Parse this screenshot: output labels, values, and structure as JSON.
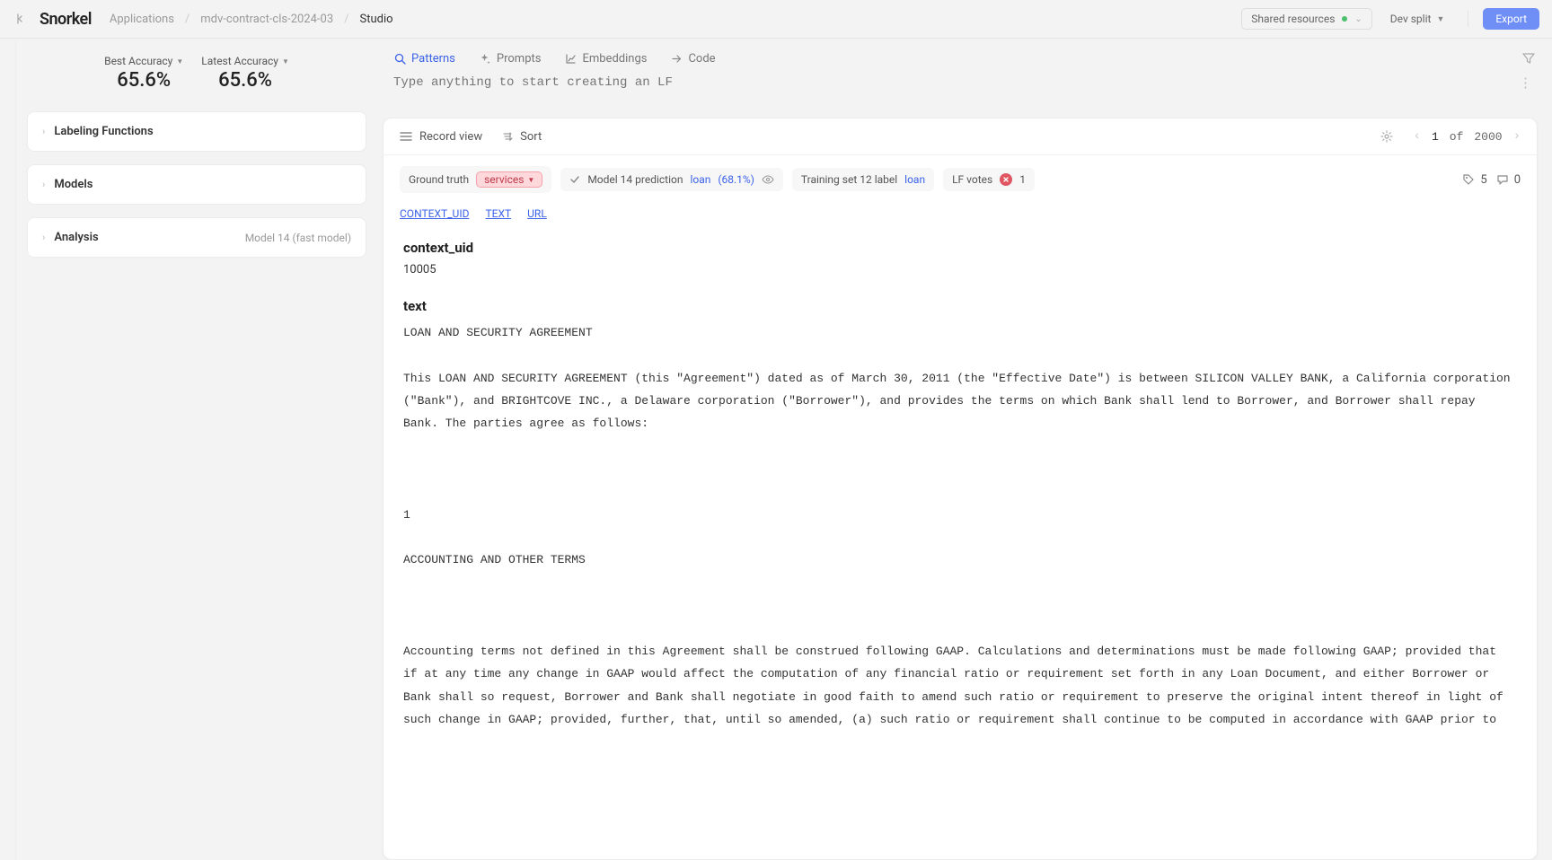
{
  "nav": {
    "logo": "Snorkel",
    "breadcrumbs": [
      "Applications",
      "mdv-contract-cls-2024-03",
      "Studio"
    ],
    "shared_resources": "Shared resources",
    "dev_split": "Dev split",
    "export": "Export"
  },
  "sidebar": {
    "best_accuracy_label": "Best Accuracy",
    "best_accuracy_value": "65.6%",
    "latest_accuracy_label": "Latest Accuracy",
    "latest_accuracy_value": "65.6%",
    "panels": {
      "labeling_functions": "Labeling Functions",
      "models": "Models",
      "analysis": "Analysis",
      "analysis_meta": "Model 14 (fast model)"
    }
  },
  "tabs": {
    "patterns": "Patterns",
    "prompts": "Prompts",
    "embeddings": "Embeddings",
    "code": "Code",
    "lf_placeholder": "Type anything to start creating an LF"
  },
  "card": {
    "record_view": "Record view",
    "sort": "Sort",
    "pager_current": "1",
    "pager_of": "of",
    "pager_total": "2000",
    "chips": {
      "ground_truth_label": "Ground truth",
      "ground_truth_value": "services",
      "model_pred_label": "Model 14 prediction",
      "model_pred_value": "loan",
      "model_pred_pct": "(68.1%)",
      "train_label": "Training set 12 label",
      "train_value": "loan",
      "lf_votes_label": "LF votes",
      "lf_votes_count": "1",
      "tags_count": "5",
      "comments_count": "0"
    },
    "anchors": [
      "CONTEXT_UID",
      "TEXT",
      "URL"
    ],
    "context_uid_heading": "context_uid",
    "context_uid_value": "10005",
    "text_heading": "text",
    "document_text": "LOAN AND SECURITY AGREEMENT\n\nThis LOAN AND SECURITY AGREEMENT (this \"Agreement\") dated as of March 30, 2011 (the \"Effective Date\") is between SILICON VALLEY BANK, a California corporation (\"Bank\"), and BRIGHTCOVE INC., a Delaware corporation (\"Borrower\"), and provides the terms on which Bank shall lend to Borrower, and Borrower shall repay Bank. The parties agree as follows:\n\n\n\n1\n\nACCOUNTING AND OTHER TERMS\n\n\n\nAccounting terms not defined in this Agreement shall be construed following GAAP. Calculations and determinations must be made following GAAP; provided that if at any time any change in GAAP would affect the computation of any financial ratio or requirement set forth in any Loan Document, and either Borrower or Bank shall so request, Borrower and Bank shall negotiate in good faith to amend such ratio or requirement to preserve the original intent thereof in light of such change in GAAP; provided, further, that, until so amended, (a) such ratio or requirement shall continue to be computed in accordance with GAAP prior to"
  }
}
